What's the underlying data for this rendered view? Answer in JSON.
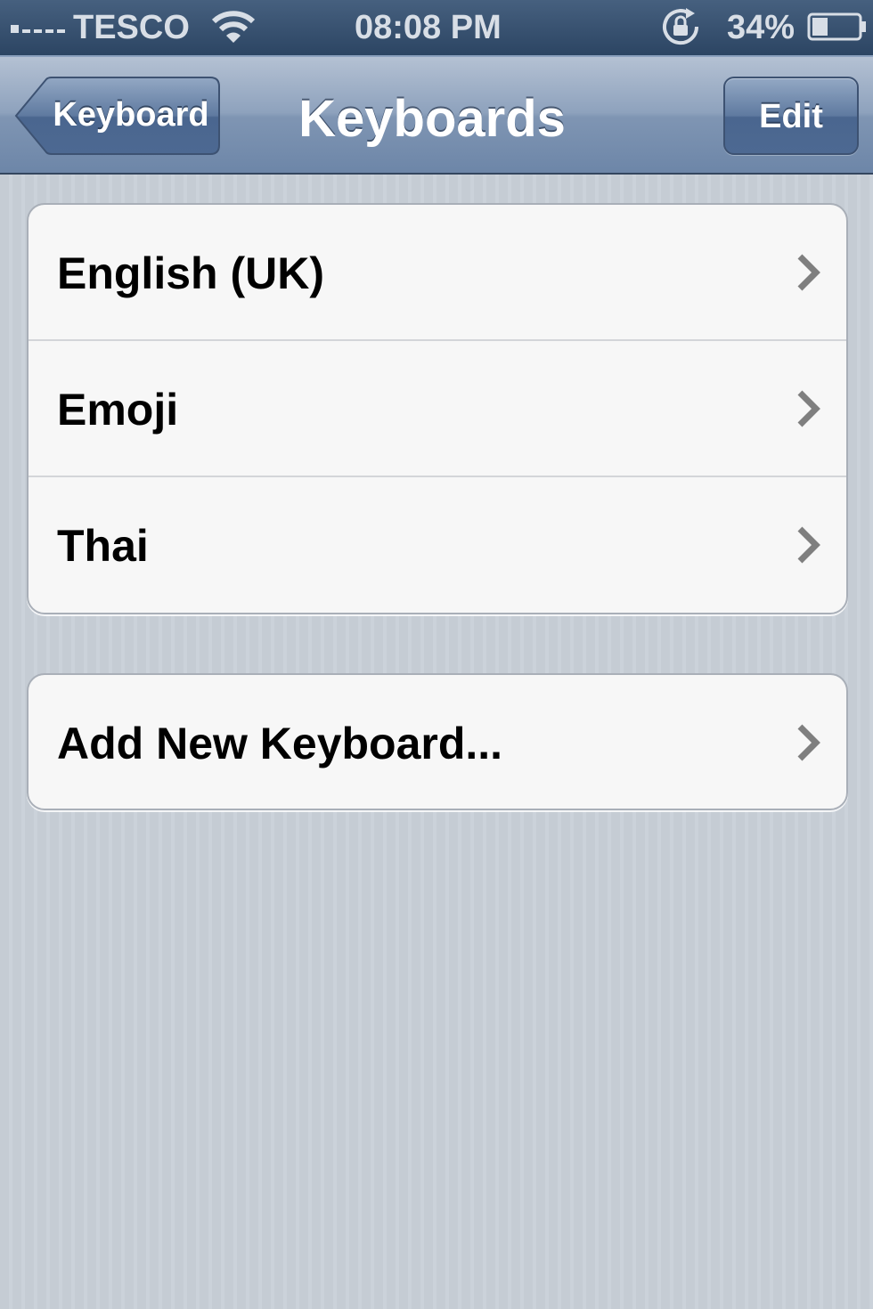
{
  "status_bar": {
    "carrier": "TESCO",
    "time": "08:08 PM",
    "battery_percent": "34%",
    "battery_level": 0.34,
    "icons": [
      "signal-icon",
      "wifi-icon",
      "rotation-lock-icon",
      "battery-icon"
    ]
  },
  "nav": {
    "back_label": "Keyboard",
    "title": "Keyboards",
    "edit_label": "Edit"
  },
  "keyboards": [
    {
      "label": "English (UK)"
    },
    {
      "label": "Emoji"
    },
    {
      "label": "Thai"
    }
  ],
  "add_keyboard": {
    "label": "Add New Keyboard..."
  },
  "colors": {
    "nav_bar": "#7f95b3",
    "status_bar": "#2c4563",
    "background": "#c5ccd4",
    "cell_background": "#f7f7f7",
    "chevron": "#7f7f7f"
  }
}
